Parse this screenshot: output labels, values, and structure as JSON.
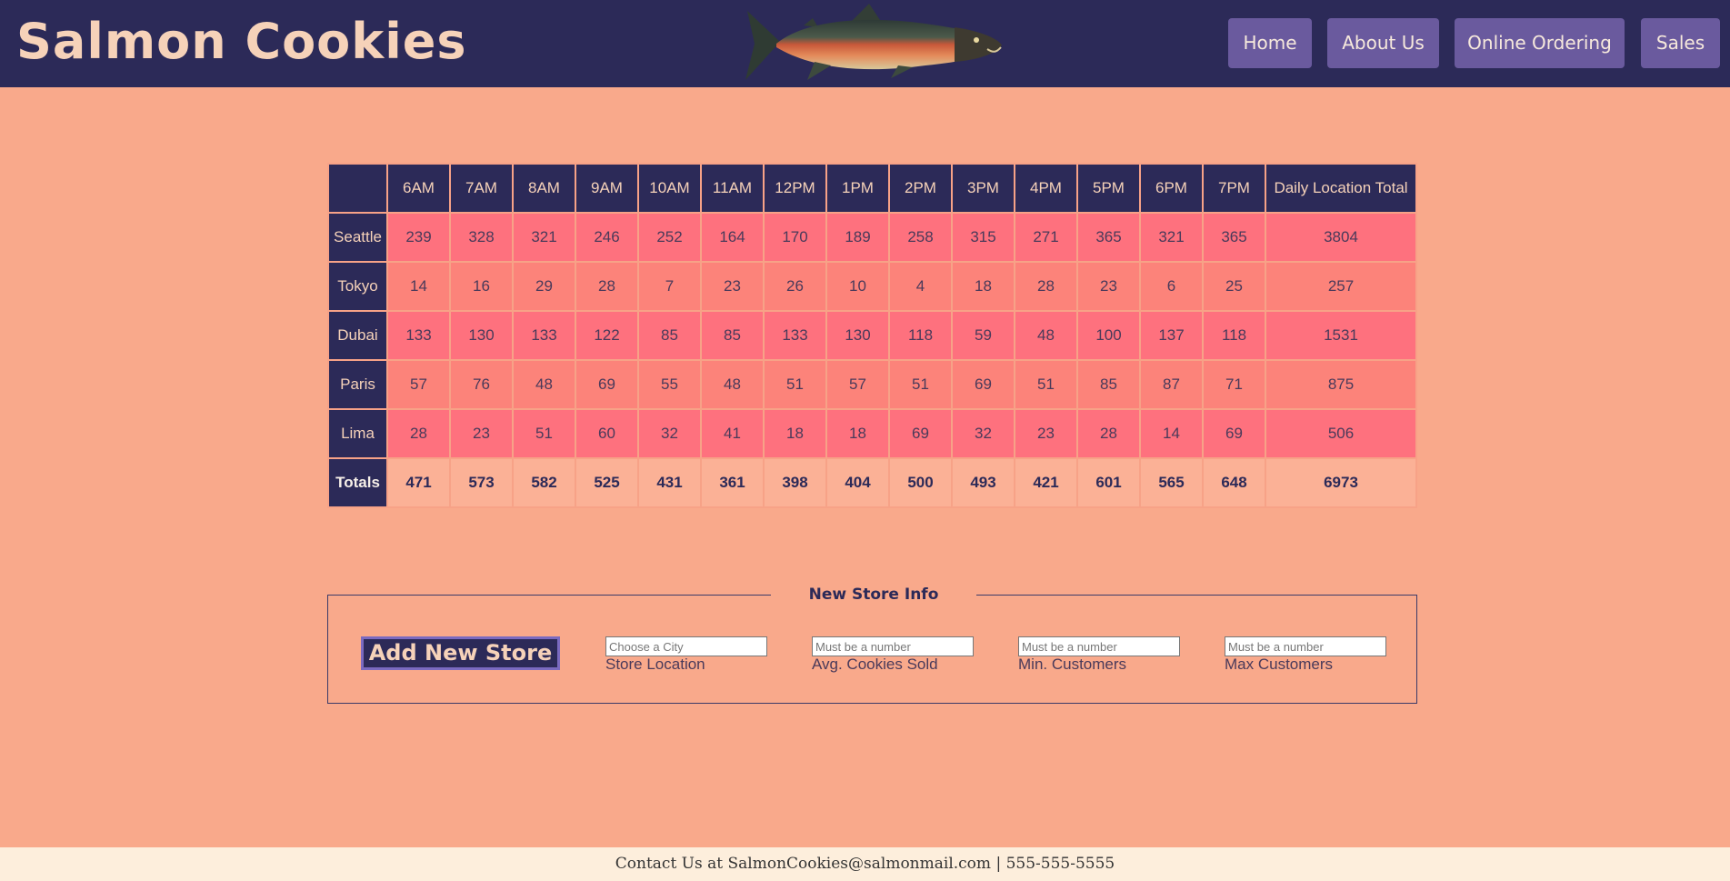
{
  "header": {
    "brand": "Salmon Cookies",
    "nav": [
      "Home",
      "About Us",
      "Online Ordering",
      "Sales"
    ]
  },
  "table": {
    "headers": [
      "",
      "6AM",
      "7AM",
      "8AM",
      "9AM",
      "10AM",
      "11AM",
      "12PM",
      "1PM",
      "2PM",
      "3PM",
      "4PM",
      "5PM",
      "6PM",
      "7PM",
      "Daily Location Total"
    ],
    "rows": [
      {
        "location": "Seattle",
        "values": [
          "239",
          "328",
          "321",
          "246",
          "252",
          "164",
          "170",
          "189",
          "258",
          "315",
          "271",
          "365",
          "321",
          "365"
        ],
        "total": "3804"
      },
      {
        "location": "Tokyo",
        "values": [
          "14",
          "16",
          "29",
          "28",
          "7",
          "23",
          "26",
          "10",
          "4",
          "18",
          "28",
          "23",
          "6",
          "25"
        ],
        "total": "257"
      },
      {
        "location": "Dubai",
        "values": [
          "133",
          "130",
          "133",
          "122",
          "85",
          "85",
          "133",
          "130",
          "118",
          "59",
          "48",
          "100",
          "137",
          "118"
        ],
        "total": "1531"
      },
      {
        "location": "Paris",
        "values": [
          "57",
          "76",
          "48",
          "69",
          "55",
          "48",
          "51",
          "57",
          "51",
          "69",
          "51",
          "85",
          "87",
          "71"
        ],
        "total": "875"
      },
      {
        "location": "Lima",
        "values": [
          "28",
          "23",
          "51",
          "60",
          "32",
          "41",
          "18",
          "18",
          "69",
          "32",
          "23",
          "28",
          "14",
          "69"
        ],
        "total": "506"
      }
    ],
    "totals": {
      "label": "Totals",
      "values": [
        "471",
        "573",
        "582",
        "525",
        "431",
        "361",
        "398",
        "404",
        "500",
        "493",
        "421",
        "601",
        "565",
        "648"
      ],
      "total": "6973"
    }
  },
  "form": {
    "legend": "New Store Info",
    "submit_label": "Add New Store",
    "fields": [
      {
        "placeholder": "Choose a City",
        "label": "Store Location"
      },
      {
        "placeholder": "Must be a number",
        "label": "Avg. Cookies Sold"
      },
      {
        "placeholder": "Must be a number",
        "label": "Min. Customers"
      },
      {
        "placeholder": "Must be a number",
        "label": "Max Customers"
      }
    ]
  },
  "footer": {
    "text": "Contact Us at SalmonCookies@salmonmail.com | 555-555-5555"
  },
  "colors": {
    "page_bg": "#f9a98b",
    "navy": "#2c2a58",
    "nav_button": "#6a5a9e",
    "row_dark": "#fe717e",
    "row_light": "#fc837a",
    "totals_row": "#fbb196",
    "footer_bg": "#fdeedc"
  },
  "icons": {
    "hero": "salmon-fish-image"
  }
}
